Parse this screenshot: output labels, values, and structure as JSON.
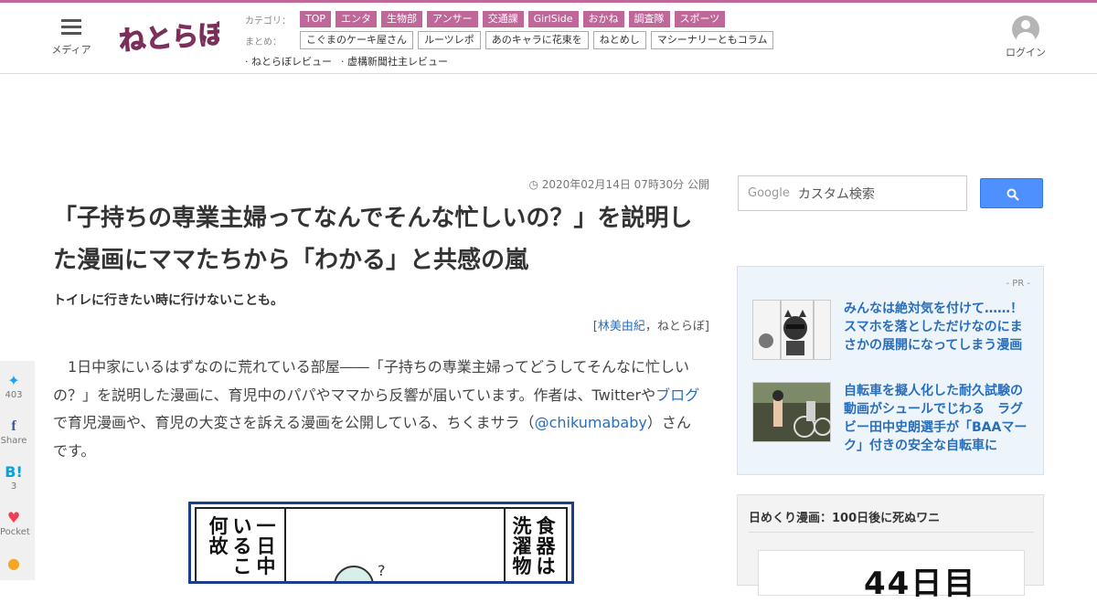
{
  "header": {
    "menu_label": "メディア",
    "login_label": "ログイン",
    "category_head": "カテゴリ：",
    "categories": [
      "TOP",
      "エンタ",
      "生物部",
      "アンサー",
      "交通課",
      "GirlSide",
      "おかね",
      "調査隊",
      "スポーツ"
    ],
    "matome_head": "まとめ：",
    "matome": [
      "こぐまのケーキ屋さん",
      "ルーツレポ",
      "あのキャラに花束を",
      "ねとめし",
      "マシーナリーともコラム"
    ],
    "reviews": [
      "· ねとらぼレビュー",
      "· 虚構新聞社主レビュー"
    ],
    "brand_color": "#c0679a"
  },
  "article": {
    "date": "2020年02月14日 07時30分 公開",
    "title": "「子持ちの専業主婦ってなんでそんな忙しいの？」を説明した漫画にママたちから「わかる」と共感の嵐",
    "subtitle": "トイレに行きたい時に行けないことも。",
    "byline_open": "[",
    "author": "林美由紀",
    "byline_sep": "，",
    "outlet": "ねとらぼ",
    "byline_close": "]",
    "body_p1": "1日中家にいるはずなのに荒れている部屋――「子持ちの専業主婦ってどうしてそんなに忙しいの？」を説明した漫画に、育児中のパパやママから反響が届いています。作者は、Twitterや",
    "body_link_blog": "ブログ",
    "body_p2": "で育児漫画や、育児の大変さを訴える漫画を公開している、ちくまサラ（",
    "body_link_twitter": "@chikumababy",
    "body_p3": "）さんです。"
  },
  "share": [
    {
      "icon": "twitter-icon",
      "count": "403"
    },
    {
      "icon": "facebook-icon",
      "count": "Share"
    },
    {
      "icon": "hatena-icon",
      "count": "3"
    },
    {
      "icon": "pocket-icon",
      "count": "Pocket"
    },
    {
      "icon": "line-icon",
      "count": ""
    }
  ],
  "manga": {
    "col1": "何故",
    "col2": "いるこ",
    "col3": "一日中",
    "col4": "洗濯物",
    "col5": "食器は",
    "question": "?"
  },
  "sidebar": {
    "search_logo": "Google",
    "search_placeholder": "カスタム検索",
    "pr_label": "- PR -",
    "pr_items": [
      {
        "text": "みんなは絶対気を付けて……！　スマホを落としただけなのにまさかの展開になってしまう漫画"
      },
      {
        "text": "自転車を擬人化した耐久試験の動画がシュールでじわる　ラグビー田中史朗選手が「BAAマーク」付きの安全な自転車に"
      }
    ],
    "wani_title": "日めくり漫画：100日後に死ぬワニ",
    "wani_number": "44日目"
  }
}
